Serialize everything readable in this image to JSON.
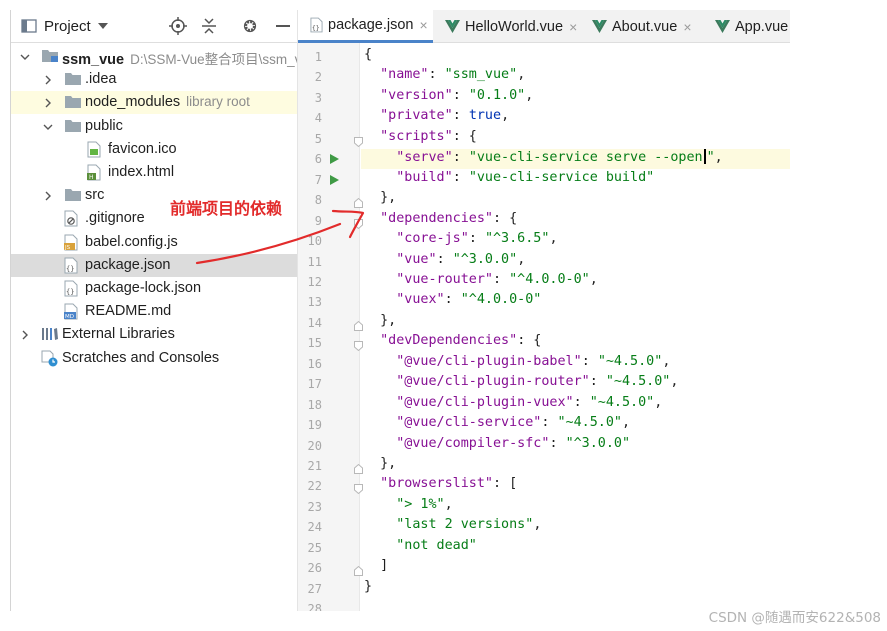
{
  "project_panel": {
    "title": "Project",
    "icons": [
      "project-window-icon",
      "dropdown-chevron-icon",
      "locate-icon",
      "collapse-all-icon",
      "settings-gear-icon",
      "hide-icon"
    ],
    "tree": [
      {
        "label": "ssm_vue",
        "hint": "D:\\SSM-Vue整合项目\\ssm_vue",
        "type": "module-folder",
        "expanded": true,
        "depth": 0
      },
      {
        "label": ".idea",
        "type": "folder",
        "expanded": false,
        "depth": 1
      },
      {
        "label": "node_modules",
        "hint": "library root",
        "type": "folder",
        "expanded": false,
        "depth": 1,
        "highlight": "excluded"
      },
      {
        "label": "public",
        "type": "folder",
        "expanded": true,
        "depth": 1
      },
      {
        "label": "favicon.ico",
        "type": "image-file",
        "depth": 2
      },
      {
        "label": "index.html",
        "type": "html-file",
        "depth": 2
      },
      {
        "label": "src",
        "type": "folder",
        "expanded": false,
        "depth": 1
      },
      {
        "label": ".gitignore",
        "type": "ignore-file",
        "depth": 1
      },
      {
        "label": "babel.config.js",
        "type": "js-file",
        "depth": 1
      },
      {
        "label": "package.json",
        "type": "json-file",
        "depth": 1,
        "selected": true
      },
      {
        "label": "package-lock.json",
        "type": "json-file",
        "depth": 1
      },
      {
        "label": "README.md",
        "type": "md-file",
        "depth": 1
      },
      {
        "label": "External Libraries",
        "type": "libraries",
        "expanded": false,
        "depth": 0
      },
      {
        "label": "Scratches and Consoles",
        "type": "scratches",
        "depth": 0
      }
    ]
  },
  "editor": {
    "tabs": [
      {
        "label": "package.json",
        "icon": "json-file-icon",
        "active": true,
        "closable": true
      },
      {
        "label": "HelloWorld.vue",
        "icon": "vue-file-icon",
        "active": false,
        "closable": true
      },
      {
        "label": "About.vue",
        "icon": "vue-file-icon",
        "active": false,
        "closable": true
      },
      {
        "label": "App.vue",
        "icon": "vue-file-icon",
        "active": false,
        "closable": false
      }
    ],
    "close_glyph": "×",
    "current_line": 6,
    "run_lines": [
      6,
      7
    ],
    "lines": [
      [
        [
          "p",
          "{"
        ]
      ],
      [
        [
          "p",
          "  "
        ],
        [
          "key",
          "\"name\""
        ],
        [
          "p",
          ": "
        ],
        [
          "str",
          "\"ssm_vue\""
        ],
        [
          "p",
          ","
        ]
      ],
      [
        [
          "p",
          "  "
        ],
        [
          "key",
          "\"version\""
        ],
        [
          "p",
          ": "
        ],
        [
          "str",
          "\"0.1.0\""
        ],
        [
          "p",
          ","
        ]
      ],
      [
        [
          "p",
          "  "
        ],
        [
          "key",
          "\"private\""
        ],
        [
          "p",
          ": "
        ],
        [
          "kw",
          "true"
        ],
        [
          "p",
          ","
        ]
      ],
      [
        [
          "p",
          "  "
        ],
        [
          "key",
          "\"scripts\""
        ],
        [
          "p",
          ": {"
        ]
      ],
      [
        [
          "p",
          "    "
        ],
        [
          "key",
          "\"serve\""
        ],
        [
          "p",
          ": "
        ],
        [
          "str",
          "\"vue-cli-service serve --open"
        ],
        [
          "caret",
          ""
        ],
        [
          "str",
          "\""
        ],
        [
          "p",
          ","
        ]
      ],
      [
        [
          "p",
          "    "
        ],
        [
          "key",
          "\"build\""
        ],
        [
          "p",
          ": "
        ],
        [
          "str",
          "\"vue-cli-service build\""
        ]
      ],
      [
        [
          "p",
          "  },"
        ]
      ],
      [
        [
          "p",
          "  "
        ],
        [
          "key",
          "\"dependencies\""
        ],
        [
          "p",
          ": {"
        ]
      ],
      [
        [
          "p",
          "    "
        ],
        [
          "key",
          "\"core-js\""
        ],
        [
          "p",
          ": "
        ],
        [
          "str",
          "\"^3.6.5\""
        ],
        [
          "p",
          ","
        ]
      ],
      [
        [
          "p",
          "    "
        ],
        [
          "key",
          "\"vue\""
        ],
        [
          "p",
          ": "
        ],
        [
          "str",
          "\"^3.0.0\""
        ],
        [
          "p",
          ","
        ]
      ],
      [
        [
          "p",
          "    "
        ],
        [
          "key",
          "\"vue-router\""
        ],
        [
          "p",
          ": "
        ],
        [
          "str",
          "\"^4.0.0-0\""
        ],
        [
          "p",
          ","
        ]
      ],
      [
        [
          "p",
          "    "
        ],
        [
          "key",
          "\"vuex\""
        ],
        [
          "p",
          ": "
        ],
        [
          "str",
          "\"^4.0.0-0\""
        ]
      ],
      [
        [
          "p",
          "  },"
        ]
      ],
      [
        [
          "p",
          "  "
        ],
        [
          "key",
          "\"devDependencies\""
        ],
        [
          "p",
          ": {"
        ]
      ],
      [
        [
          "p",
          "    "
        ],
        [
          "key",
          "\"@vue/cli-plugin-babel\""
        ],
        [
          "p",
          ": "
        ],
        [
          "str",
          "\"~4.5.0\""
        ],
        [
          "p",
          ","
        ]
      ],
      [
        [
          "p",
          "    "
        ],
        [
          "key",
          "\"@vue/cli-plugin-router\""
        ],
        [
          "p",
          ": "
        ],
        [
          "str",
          "\"~4.5.0\""
        ],
        [
          "p",
          ","
        ]
      ],
      [
        [
          "p",
          "    "
        ],
        [
          "key",
          "\"@vue/cli-plugin-vuex\""
        ],
        [
          "p",
          ": "
        ],
        [
          "str",
          "\"~4.5.0\""
        ],
        [
          "p",
          ","
        ]
      ],
      [
        [
          "p",
          "    "
        ],
        [
          "key",
          "\"@vue/cli-service\""
        ],
        [
          "p",
          ": "
        ],
        [
          "str",
          "\"~4.5.0\""
        ],
        [
          "p",
          ","
        ]
      ],
      [
        [
          "p",
          "    "
        ],
        [
          "key",
          "\"@vue/compiler-sfc\""
        ],
        [
          "p",
          ": "
        ],
        [
          "str",
          "\"^3.0.0\""
        ]
      ],
      [
        [
          "p",
          "  },"
        ]
      ],
      [
        [
          "p",
          "  "
        ],
        [
          "key",
          "\"browserslist\""
        ],
        [
          "p",
          ": ["
        ]
      ],
      [
        [
          "p",
          "    "
        ],
        [
          "str",
          "\"> 1%\""
        ],
        [
          "p",
          ","
        ]
      ],
      [
        [
          "p",
          "    "
        ],
        [
          "str",
          "\"last 2 versions\""
        ],
        [
          "p",
          ","
        ]
      ],
      [
        [
          "p",
          "    "
        ],
        [
          "str",
          "\"not dead\""
        ]
      ],
      [
        [
          "p",
          "  ]"
        ]
      ],
      [
        [
          "p",
          "}"
        ]
      ],
      []
    ]
  },
  "annotation": {
    "text": "前端项目的依赖",
    "color": "#e22b2b"
  },
  "watermark": "CSDN @随遇而安622&508",
  "colors": {
    "json_key": "#871094",
    "string": "#067d17",
    "keyword": "#0033b3",
    "active_tab_underline": "#4a83c9",
    "selection_gray": "#dcdcdc",
    "excluded_yellow": "#fefce0",
    "run_green": "#3f9a45"
  }
}
